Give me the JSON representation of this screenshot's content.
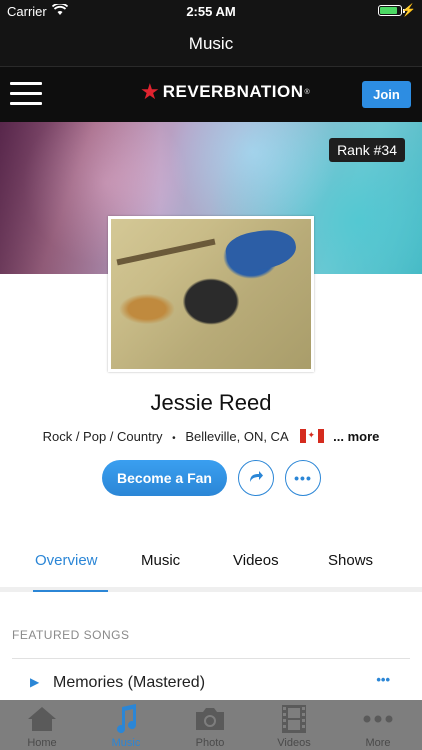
{
  "status_bar": {
    "carrier": "Carrier",
    "time": "2:55 AM"
  },
  "nav": {
    "title": "Music"
  },
  "header": {
    "logo_text": "REVERBNATION",
    "logo_mark": "®",
    "join_label": "Join"
  },
  "profile": {
    "rank": "Rank #34",
    "name": "Jessie Reed",
    "genres": "Rock / Pop / Country",
    "separator": "•",
    "location": "Belleville, ON, CA",
    "more_label": "... more",
    "fan_button": "Become a Fan",
    "more_button": "•••"
  },
  "tabs": [
    {
      "label": "Overview",
      "active": true
    },
    {
      "label": "Music",
      "active": false
    },
    {
      "label": "Videos",
      "active": false
    },
    {
      "label": "Shows",
      "active": false
    }
  ],
  "featured": {
    "title": "FEATURED SONGS",
    "songs": [
      {
        "title": "Memories (Mastered)",
        "more": "•••"
      }
    ]
  },
  "tab_bar": {
    "items": [
      {
        "label": "Home",
        "icon": "home-icon",
        "active": false
      },
      {
        "label": "Music",
        "icon": "music-note-icon",
        "active": true
      },
      {
        "label": "Photo",
        "icon": "camera-icon",
        "active": false
      },
      {
        "label": "Videos",
        "icon": "film-icon",
        "active": false
      },
      {
        "label": "More",
        "icon": "more-dots-icon",
        "active": false
      }
    ]
  },
  "colors": {
    "accent": "#2b86d6",
    "brand_red": "#e0232f",
    "join_blue": "#2d8de2",
    "tab_bar_bg": "#7e7e7e"
  }
}
